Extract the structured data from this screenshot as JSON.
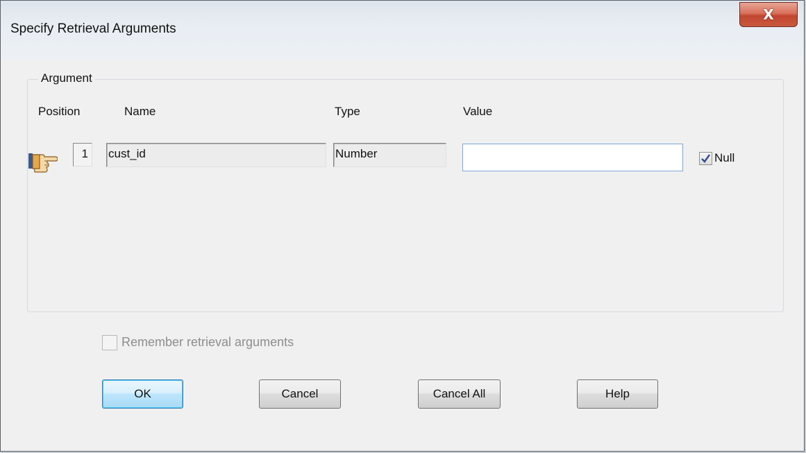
{
  "window": {
    "title": "Specify Retrieval Arguments",
    "close_label": "X"
  },
  "argument_group": {
    "label": "Argument",
    "columns": {
      "position": "Position",
      "name": "Name",
      "type": "Type",
      "value": "Value"
    },
    "rows": [
      {
        "position": "1",
        "name": "cust_id",
        "type": "Number",
        "value": "",
        "null_label": "Null",
        "null_checked": true,
        "indicator_icon": "pointing-hand-icon"
      }
    ]
  },
  "options": {
    "remember_label": "Remember retrieval arguments",
    "remember_checked": false,
    "remember_enabled": false
  },
  "buttons": {
    "ok": "OK",
    "cancel": "Cancel",
    "cancel_all": "Cancel All",
    "help": "Help"
  },
  "colors": {
    "close_button": "#c75a3f",
    "default_button": "#bee6fd",
    "check_mark": "#2d4b8e"
  }
}
